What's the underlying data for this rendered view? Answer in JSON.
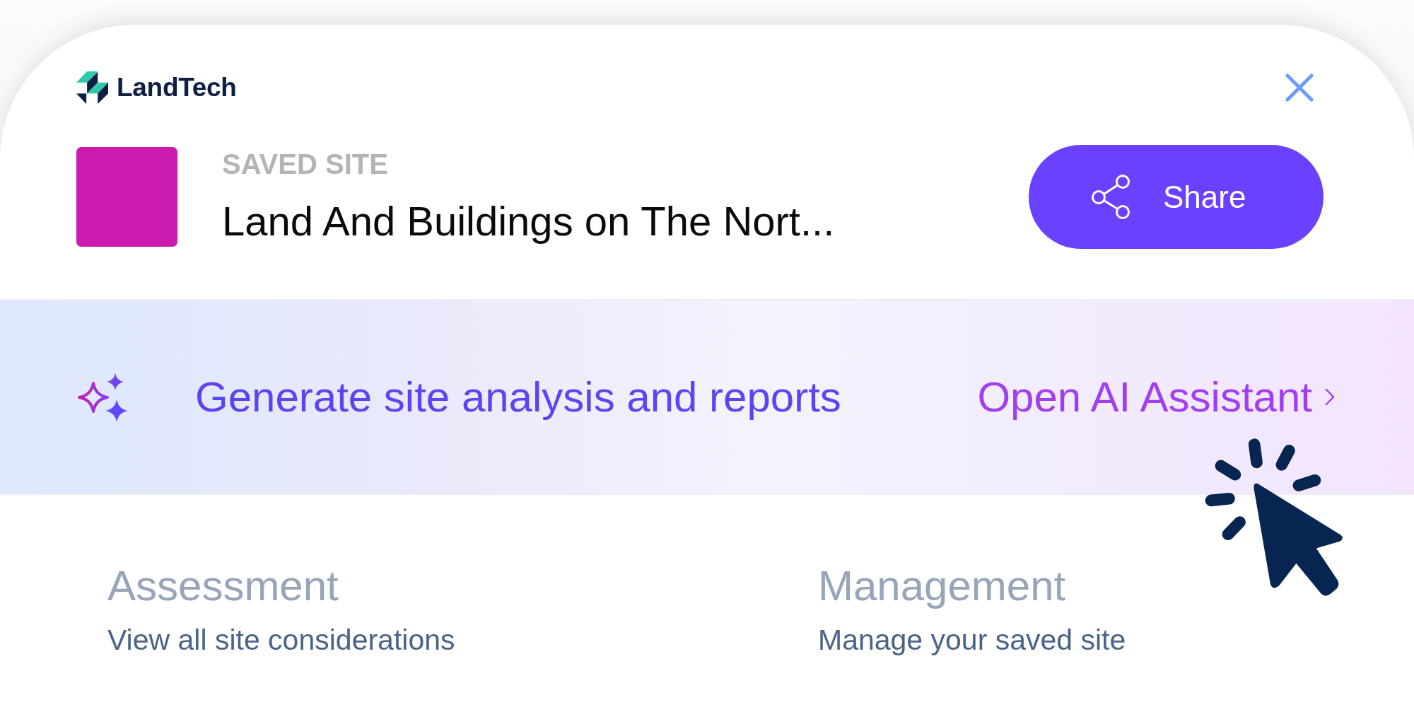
{
  "logo": {
    "text": "LandTech"
  },
  "site": {
    "label": "SAVED SITE",
    "name": "Land And Buildings on The Nort..."
  },
  "share_button": {
    "label": "Share"
  },
  "ai_banner": {
    "text": "Generate site analysis and reports",
    "link": "Open AI Assistant"
  },
  "sections": [
    {
      "title": "Assessment",
      "subtitle": "View all site considerations"
    },
    {
      "title": "Management",
      "subtitle": "Manage your saved site"
    }
  ]
}
